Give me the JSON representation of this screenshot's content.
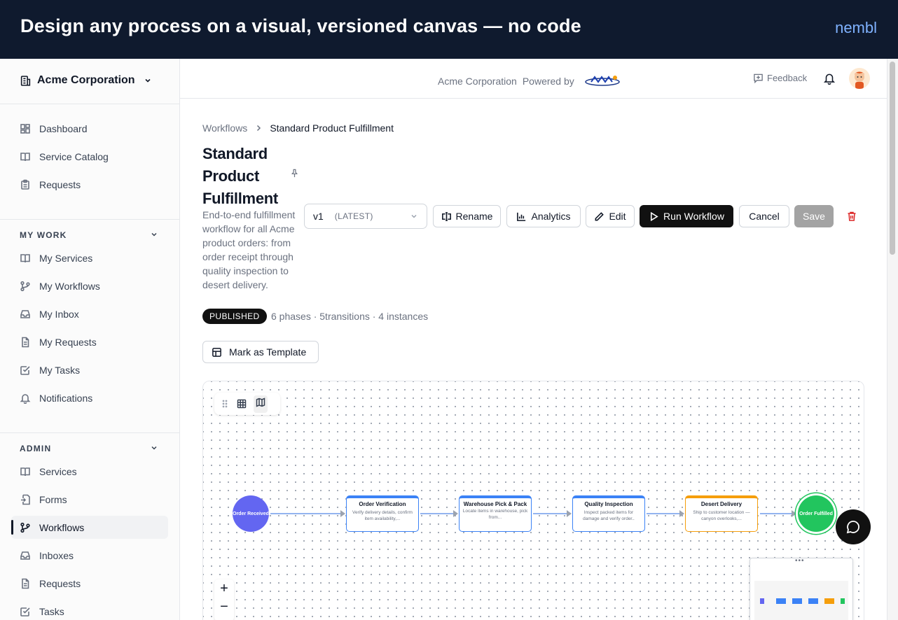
{
  "banner": {
    "title": "Design any process on a visual, versioned canvas — no code",
    "brand": "nembl"
  },
  "sidebar": {
    "org_name": "Acme Corporation",
    "top_items": [
      {
        "label": "Dashboard",
        "icon": "dashboard-icon"
      },
      {
        "label": "Service Catalog",
        "icon": "book-icon"
      },
      {
        "label": "Requests",
        "icon": "clipboard-icon"
      }
    ],
    "my_work": {
      "heading": "MY WORK",
      "items": [
        {
          "label": "My Services",
          "icon": "book-icon"
        },
        {
          "label": "My Workflows",
          "icon": "workflow-icon"
        },
        {
          "label": "My Inbox",
          "icon": "inbox-icon"
        },
        {
          "label": "My Requests",
          "icon": "document-icon"
        },
        {
          "label": "My Tasks",
          "icon": "checkbox-icon"
        },
        {
          "label": "Notifications",
          "icon": "bell-icon"
        }
      ]
    },
    "admin": {
      "heading": "ADMIN",
      "items": [
        {
          "label": "Services",
          "icon": "book-icon"
        },
        {
          "label": "Forms",
          "icon": "form-icon"
        },
        {
          "label": "Workflows",
          "icon": "workflow-icon"
        },
        {
          "label": "Inboxes",
          "icon": "inbox-icon"
        },
        {
          "label": "Requests",
          "icon": "document-icon"
        },
        {
          "label": "Tasks",
          "icon": "checkbox-icon"
        }
      ]
    }
  },
  "topbar": {
    "org": "Acme Corporation",
    "powered_by": "Powered by",
    "feedback": "Feedback"
  },
  "breadcrumb": {
    "root": "Workflows",
    "current": "Standard Product Fulfillment"
  },
  "workflow": {
    "title": "Standard Product Fulfillment",
    "description": "End-to-end fulfillment workflow for all Acme product orders: from order receipt through quality inspection to desert delivery.",
    "version": "v1",
    "version_tag": "(LATEST)",
    "status": "PUBLISHED",
    "stats": "6 phases · 5transitions · 4 instances"
  },
  "actions": {
    "rename": "Rename",
    "analytics": "Analytics",
    "edit": "Edit",
    "run": "Run Workflow",
    "cancel": "Cancel",
    "save": "Save",
    "mark_template": "Mark as Template"
  },
  "canvas": {
    "start": "Order Received",
    "end": "Order Fulfilled",
    "phases": [
      {
        "title": "Order Verification",
        "desc": "Verify delivery details, confirm item availability,...",
        "color": "#3b82f6"
      },
      {
        "title": "Warehouse Pick & Pack",
        "desc": "Locate items in warehouse, pick from...",
        "color": "#3b82f6"
      },
      {
        "title": "Quality Inspection",
        "desc": "Inspect packed items for damage and verify order..",
        "color": "#3b82f6"
      },
      {
        "title": "Desert Delivery",
        "desc": "Ship to customer location — canyon overlooks,...",
        "color": "#f59e0b"
      }
    ],
    "zoom_in": "+",
    "zoom_out": "−"
  },
  "colors": {
    "start_node": "#6366f1",
    "end_node": "#22c55e",
    "phase_default": "#3b82f6",
    "phase_highlight": "#f59e0b",
    "primary_button": "#111111"
  }
}
